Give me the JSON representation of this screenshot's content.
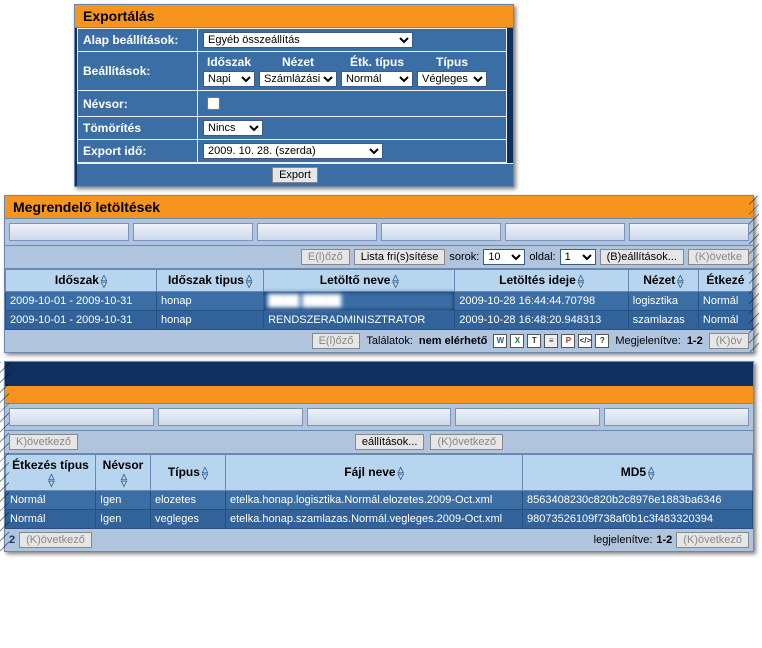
{
  "export_panel": {
    "title": "Exportálás",
    "rows": {
      "basic_label": "Alap beállítások:",
      "basic_value": "Egyéb összeállítás",
      "settings_label": "Beállítások:",
      "sub_labels": {
        "c1": "Időszak",
        "c2": "Nézet",
        "c3": "Étk. típus",
        "c4": "Típus"
      },
      "sub_values": {
        "c1": "Napi",
        "c2": "Számlázási",
        "c3": "Normál",
        "c4": "Végleges"
      },
      "nevsor_label": "Névsor:",
      "compress_label": "Tömörítés",
      "compress_value": "Nincs",
      "export_time_label": "Export idő:",
      "export_time_value": "2009. 10. 28. (szerda)"
    },
    "export_btn": "Export"
  },
  "downloads_panel": {
    "title": "Megrendelő letöltések",
    "pager": {
      "prev": "E(l)őző",
      "refresh": "Lista fri(s)sítése",
      "rows_label": "sorok:",
      "rows_value": "10",
      "page_label": "oldal:",
      "page_value": "1",
      "settings": "(B)eállítások...",
      "next": "(K)övetke"
    },
    "headers": {
      "period": "Időszak",
      "period_type": "Időszak tipus",
      "downloader": "Letöltő neve",
      "download_time": "Letöltés ideje",
      "view": "Nézet",
      "meal": "Étkezé"
    },
    "rows": [
      {
        "period": "2009-10-01 - 2009-10-31",
        "ptype": "honap",
        "name": "████ █████",
        "time": "2009-10-28 16:44:44.70798",
        "view": "logisztika",
        "meal": "Normál"
      },
      {
        "period": "2009-10-01 - 2009-10-31",
        "ptype": "honap",
        "name": "RENDSZERADMINISZTRATOR",
        "time": "2009-10-28 16:48:20.948313",
        "view": "szamlazas",
        "meal": "Normál"
      }
    ],
    "footer": {
      "prev": "E(l)őző",
      "results_label": "Találatok:",
      "results_value": "nem elérhető",
      "showing_label": "Megjelenítve:",
      "showing_value": "1-2",
      "next": "(K)öv"
    }
  },
  "files_panel": {
    "pager_left": {
      "next": "K)övetkező"
    },
    "mid_pager": {
      "settings": "eállítások...",
      "next": "(K)övetkező"
    },
    "headers": {
      "mealtype": "Étkezés típus",
      "nevsor": "Névsor",
      "type": "Típus",
      "filename": "Fájl neve",
      "md5": "MD5"
    },
    "rows": [
      {
        "meal": "Normál",
        "nevsor": "Igen",
        "type": "elozetes",
        "file": "etelka.honap.logisztika.Normál.elozetes.2009-Oct.xml",
        "md5": "8563408230c820b2c8976e1883ba6346"
      },
      {
        "meal": "Normál",
        "nevsor": "Igen",
        "type": "vegleges",
        "file": "etelka.honap.szamlazas.Normál.vegleges.2009-Oct.xml",
        "md5": "98073526109f738af0b1c3f483320394"
      }
    ],
    "footer": {
      "left_num": "2",
      "left_next": "(K)övetkező",
      "showing_label": "legjelenítve:",
      "showing_value": "1-2",
      "right_next": "(K)övetkező"
    }
  },
  "icons": {
    "word": "W",
    "excel": "X",
    "txt": "T",
    "csv": "≡",
    "pdf": "P",
    "xml": "</>",
    "help": "?"
  }
}
